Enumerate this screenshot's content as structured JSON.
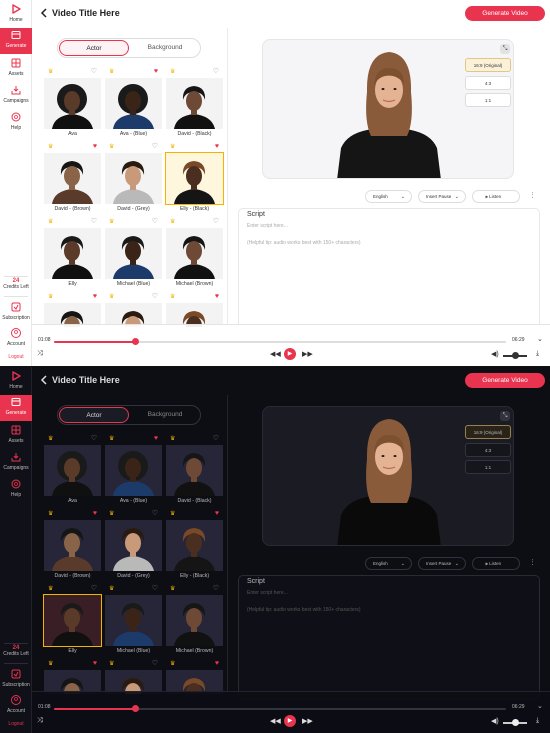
{
  "app": {
    "title": "Video Title Here",
    "generate_label": "Generate Video",
    "brand_color": "#e8344f"
  },
  "sidebar": {
    "items": [
      {
        "label": "Home",
        "icon": "logo-play-icon"
      },
      {
        "label": "Generate",
        "icon": "generate-icon"
      },
      {
        "label": "Assets",
        "icon": "assets-icon"
      },
      {
        "label": "Campaigns",
        "icon": "campaigns-icon"
      },
      {
        "label": "Help",
        "icon": "help-icon"
      }
    ],
    "credits_count": "24",
    "credits_label": "Credits Left",
    "subscription_label": "Subscription",
    "account_label": "Account",
    "logout_label": "Logout"
  },
  "tabs": {
    "actor": "Actor",
    "background": "Background"
  },
  "actors": [
    {
      "name": "Ava",
      "badge": "♛",
      "fav": "♡"
    },
    {
      "name": "Ava - (Blue)",
      "badge": "♛",
      "fav": "♥"
    },
    {
      "name": "David - (Black)",
      "badge": "♛",
      "fav": "♡"
    },
    {
      "name": "David - (Brown)",
      "badge": "♛",
      "fav": "♥"
    },
    {
      "name": "David - (Grey)",
      "badge": "♛",
      "fav": "♡"
    },
    {
      "name": "Elly - (Black)",
      "badge": "♛",
      "fav": "♥"
    },
    {
      "name": "Elly",
      "badge": "♛",
      "fav": "♡"
    },
    {
      "name": "Michael (Blue)",
      "badge": "♛",
      "fav": "♡"
    },
    {
      "name": "Michael (Brown)",
      "badge": "♛",
      "fav": "♡"
    },
    {
      "name": "",
      "badge": "♛",
      "fav": "♥"
    },
    {
      "name": "",
      "badge": "♛",
      "fav": "♡"
    },
    {
      "name": "",
      "badge": "♛",
      "fav": "♥"
    }
  ],
  "light_selected_actor": "Elly - (Black)",
  "dark_selected_actor": "Elly",
  "preview": {
    "ratios": [
      "16:9 (Original)",
      "4:3",
      "1:1"
    ],
    "selected_ratio": "16:9 (Original)"
  },
  "controls": {
    "language": "English",
    "pause": "Insert Pause",
    "listen": "Listen"
  },
  "script": {
    "label": "Script",
    "placeholder": "Enter script here...",
    "tip": "(Helpful tip: audio works best with 150+ characters)"
  },
  "player": {
    "current_time": "01:08",
    "total_time": "06:29",
    "progress": 0.18,
    "volume": 0.4
  }
}
